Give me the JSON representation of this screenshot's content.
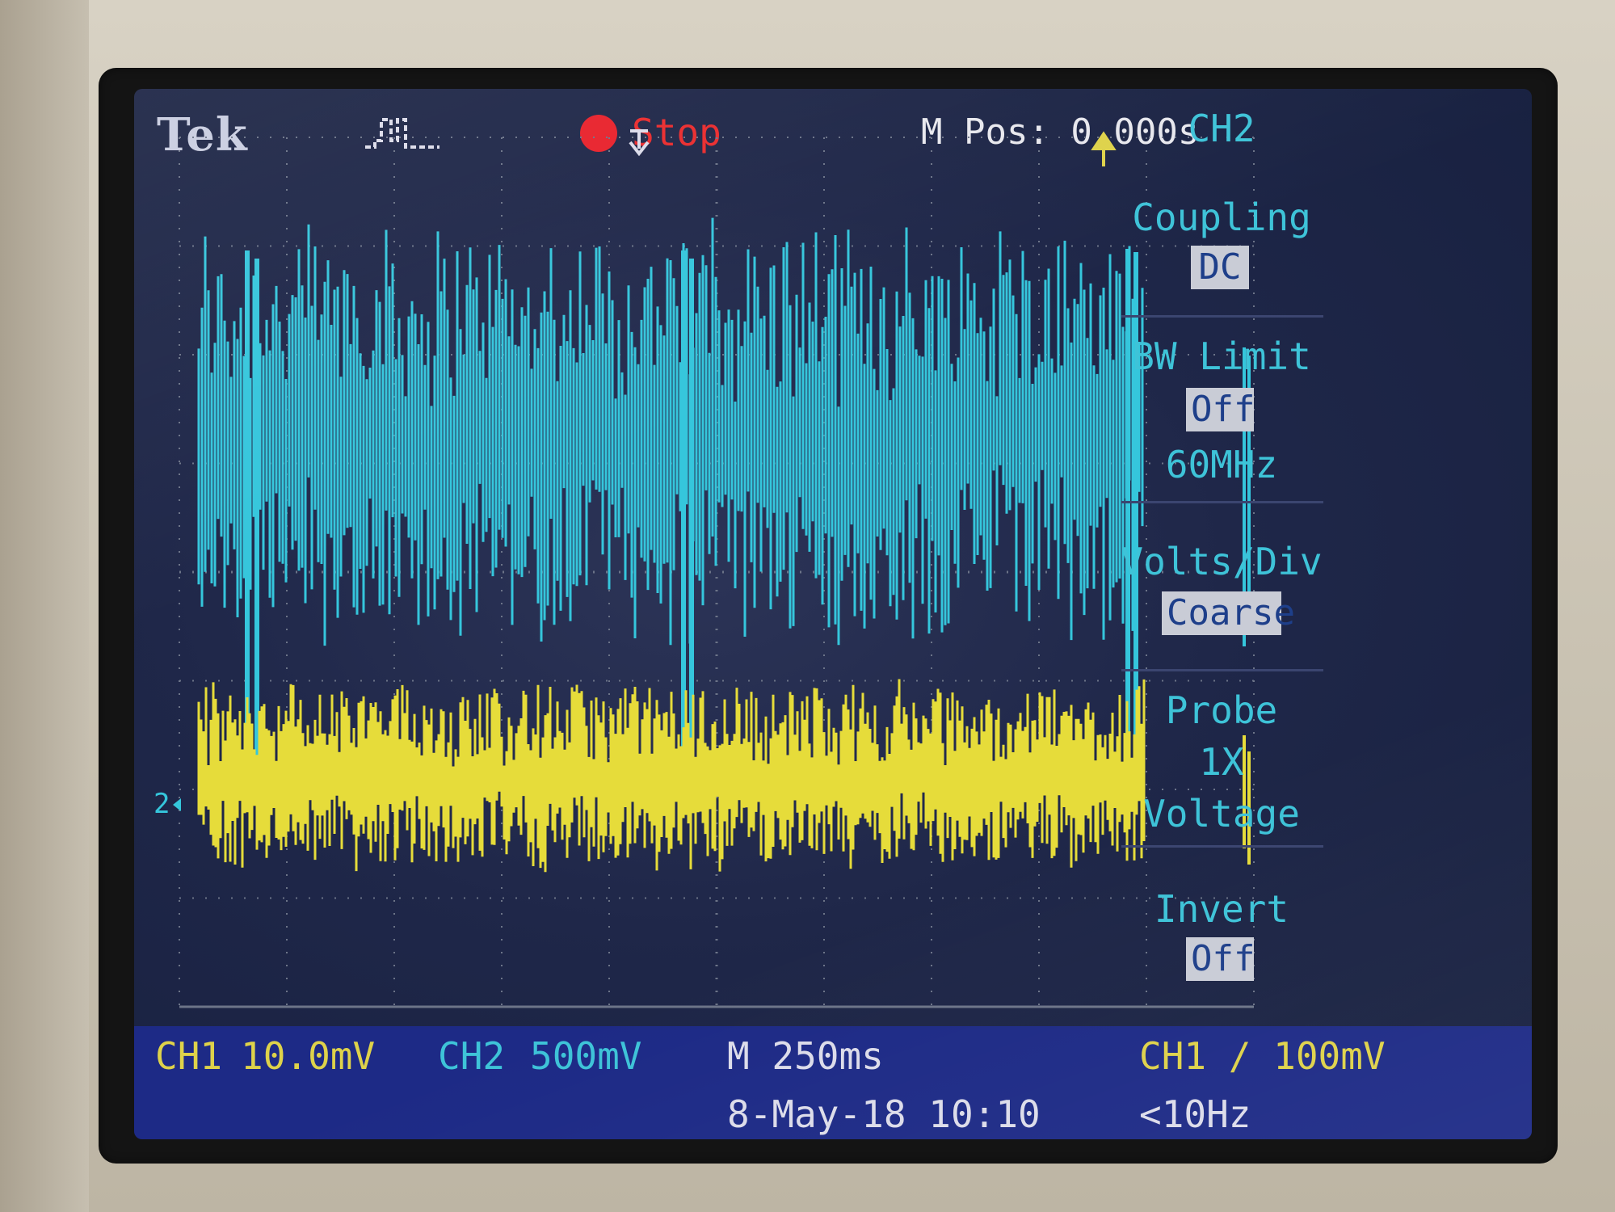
{
  "header": {
    "brand": "Tek",
    "run_state": "Stop",
    "menu_position": "M Pos: 0.000s"
  },
  "side_menu": {
    "channel": "CH2",
    "coupling": {
      "label": "Coupling",
      "value": "DC"
    },
    "bw_limit": {
      "label": "BW Limit",
      "value": "Off",
      "sub": "60MHz"
    },
    "volts_div": {
      "label": "Volts/Div",
      "value": "Coarse"
    },
    "probe": {
      "label": "Probe",
      "value": "1X",
      "sub": "Voltage"
    },
    "invert": {
      "label": "Invert",
      "value": "Off"
    }
  },
  "status_bar": {
    "ch1_label": "CH1",
    "ch1_scale": "10.0mV",
    "ch2_label": "CH2",
    "ch2_scale": "500mV",
    "timebase": "M 250ms",
    "trigger": "CH1 ∕ 100mV",
    "date": "8-May-18 10:10",
    "trigger_freq": "<10Hz"
  },
  "markers": {
    "ch2_ground": "2"
  },
  "colors": {
    "ch1": "#e6dc3a",
    "ch2": "#35c6dc",
    "grid": "#6c7488",
    "screen": "#1f2749",
    "status_bar": "#1d2a86"
  }
}
